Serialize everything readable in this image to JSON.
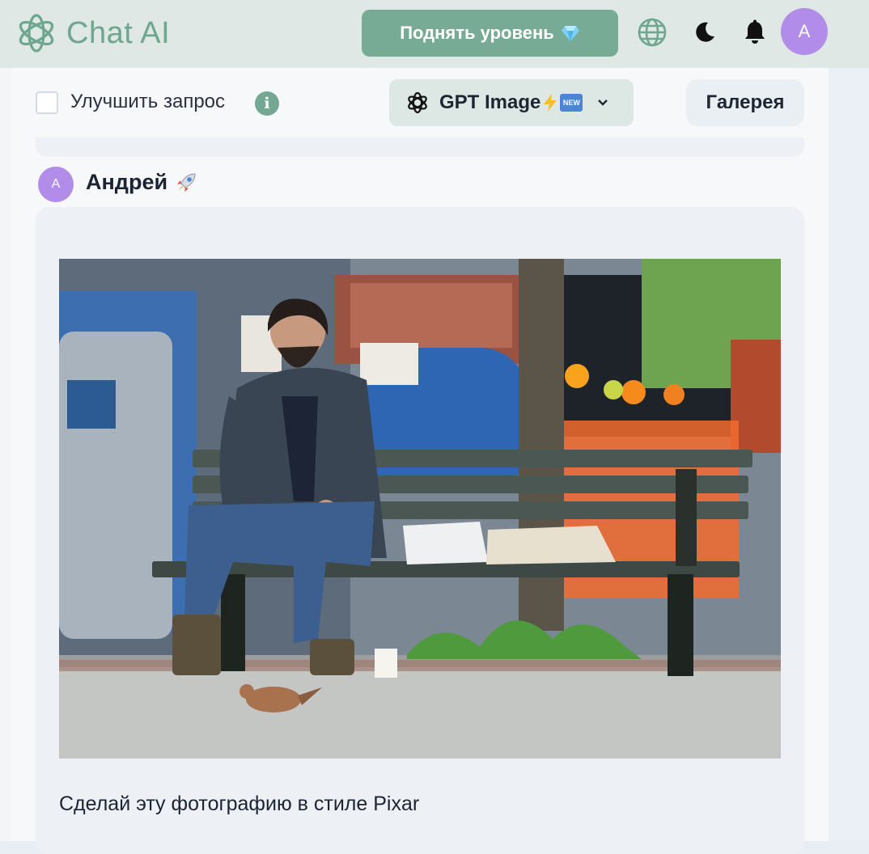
{
  "app": {
    "name": "Chat AI"
  },
  "header": {
    "upgrade_label": "Поднять уровень",
    "avatar_initial": "A"
  },
  "toolbar": {
    "improve_label": "Улучшить запрос",
    "improve_checked": false,
    "model_name": "GPT Image",
    "model_badge": "NEW",
    "gallery_label": "Галерея"
  },
  "message": {
    "avatar_initial": "A",
    "author": "Андрей",
    "text": "Сделай эту фотографию в стиле Pixar"
  },
  "icons": {
    "logo": "openai-knot-icon",
    "globe": "globe-icon",
    "theme": "moon-icon",
    "notifications": "bell-icon"
  },
  "colors": {
    "brand": "#77ab96",
    "avatar": "#b18de9",
    "header_bg": "#dfe8e4"
  }
}
